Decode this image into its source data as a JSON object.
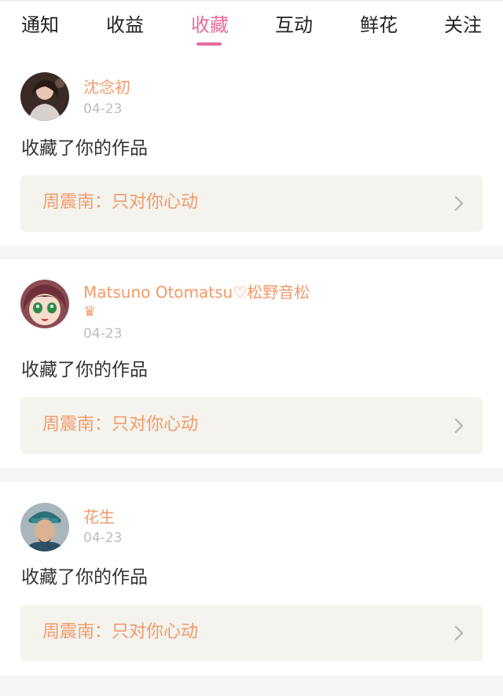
{
  "tabs": [
    {
      "label": "通知",
      "active": false
    },
    {
      "label": "收益",
      "active": false
    },
    {
      "label": "收藏",
      "active": true
    },
    {
      "label": "互动",
      "active": false
    },
    {
      "label": "鲜花",
      "active": false
    },
    {
      "label": "关注",
      "active": false
    }
  ],
  "colors": {
    "accent_pink": "#e86a9c",
    "username_orange": "#f19a6a",
    "work_card_bg": "#f4f3ee",
    "date_gray": "#bdbdbd"
  },
  "items": [
    {
      "user": "沈念初",
      "badge": "",
      "date": "04-23",
      "action": "收藏了你的作品",
      "work": "周震南：只对你心动",
      "avatar_icon": "user-avatar-icon"
    },
    {
      "user": "Matsuno Otomatsu♡松野音松",
      "badge": "♛",
      "date": "04-23",
      "action": "收藏了你的作品",
      "work": "周震南：只对你心动",
      "avatar_icon": "user-avatar-icon"
    },
    {
      "user": "花生",
      "badge": "",
      "date": "04-23",
      "action": "收藏了你的作品",
      "work": "周震南：只对你心动",
      "avatar_icon": "user-avatar-icon"
    }
  ]
}
